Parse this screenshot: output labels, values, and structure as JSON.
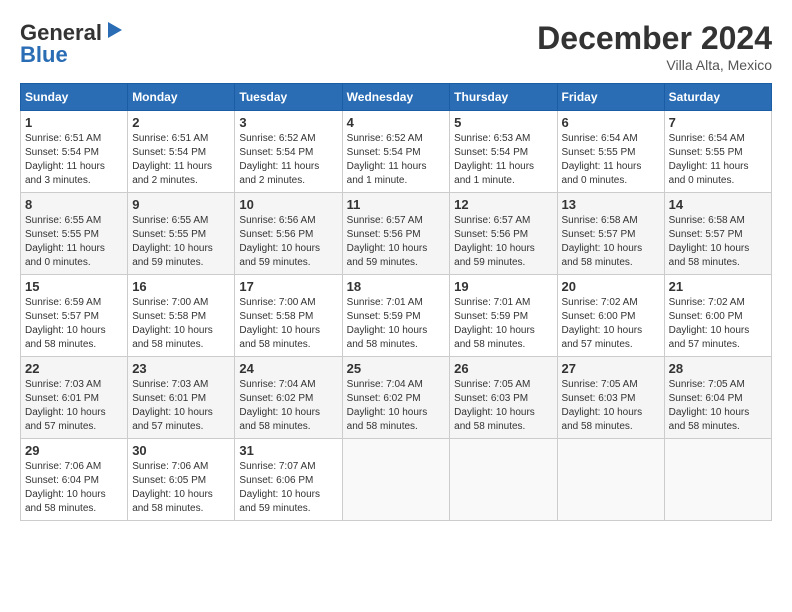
{
  "header": {
    "logo_general": "General",
    "logo_blue": "Blue",
    "month_title": "December 2024",
    "location": "Villa Alta, Mexico"
  },
  "calendar": {
    "days_of_week": [
      "Sunday",
      "Monday",
      "Tuesday",
      "Wednesday",
      "Thursday",
      "Friday",
      "Saturday"
    ],
    "weeks": [
      [
        {
          "day": "1",
          "sunrise": "6:51 AM",
          "sunset": "5:54 PM",
          "daylight": "11 hours and 3 minutes."
        },
        {
          "day": "2",
          "sunrise": "6:51 AM",
          "sunset": "5:54 PM",
          "daylight": "11 hours and 2 minutes."
        },
        {
          "day": "3",
          "sunrise": "6:52 AM",
          "sunset": "5:54 PM",
          "daylight": "11 hours and 2 minutes."
        },
        {
          "day": "4",
          "sunrise": "6:52 AM",
          "sunset": "5:54 PM",
          "daylight": "11 hours and 1 minute."
        },
        {
          "day": "5",
          "sunrise": "6:53 AM",
          "sunset": "5:54 PM",
          "daylight": "11 hours and 1 minute."
        },
        {
          "day": "6",
          "sunrise": "6:54 AM",
          "sunset": "5:55 PM",
          "daylight": "11 hours and 0 minutes."
        },
        {
          "day": "7",
          "sunrise": "6:54 AM",
          "sunset": "5:55 PM",
          "daylight": "11 hours and 0 minutes."
        }
      ],
      [
        {
          "day": "8",
          "sunrise": "6:55 AM",
          "sunset": "5:55 PM",
          "daylight": "11 hours and 0 minutes."
        },
        {
          "day": "9",
          "sunrise": "6:55 AM",
          "sunset": "5:55 PM",
          "daylight": "10 hours and 59 minutes."
        },
        {
          "day": "10",
          "sunrise": "6:56 AM",
          "sunset": "5:56 PM",
          "daylight": "10 hours and 59 minutes."
        },
        {
          "day": "11",
          "sunrise": "6:57 AM",
          "sunset": "5:56 PM",
          "daylight": "10 hours and 59 minutes."
        },
        {
          "day": "12",
          "sunrise": "6:57 AM",
          "sunset": "5:56 PM",
          "daylight": "10 hours and 59 minutes."
        },
        {
          "day": "13",
          "sunrise": "6:58 AM",
          "sunset": "5:57 PM",
          "daylight": "10 hours and 58 minutes."
        },
        {
          "day": "14",
          "sunrise": "6:58 AM",
          "sunset": "5:57 PM",
          "daylight": "10 hours and 58 minutes."
        }
      ],
      [
        {
          "day": "15",
          "sunrise": "6:59 AM",
          "sunset": "5:57 PM",
          "daylight": "10 hours and 58 minutes."
        },
        {
          "day": "16",
          "sunrise": "7:00 AM",
          "sunset": "5:58 PM",
          "daylight": "10 hours and 58 minutes."
        },
        {
          "day": "17",
          "sunrise": "7:00 AM",
          "sunset": "5:58 PM",
          "daylight": "10 hours and 58 minutes."
        },
        {
          "day": "18",
          "sunrise": "7:01 AM",
          "sunset": "5:59 PM",
          "daylight": "10 hours and 58 minutes."
        },
        {
          "day": "19",
          "sunrise": "7:01 AM",
          "sunset": "5:59 PM",
          "daylight": "10 hours and 58 minutes."
        },
        {
          "day": "20",
          "sunrise": "7:02 AM",
          "sunset": "6:00 PM",
          "daylight": "10 hours and 57 minutes."
        },
        {
          "day": "21",
          "sunrise": "7:02 AM",
          "sunset": "6:00 PM",
          "daylight": "10 hours and 57 minutes."
        }
      ],
      [
        {
          "day": "22",
          "sunrise": "7:03 AM",
          "sunset": "6:01 PM",
          "daylight": "10 hours and 57 minutes."
        },
        {
          "day": "23",
          "sunrise": "7:03 AM",
          "sunset": "6:01 PM",
          "daylight": "10 hours and 57 minutes."
        },
        {
          "day": "24",
          "sunrise": "7:04 AM",
          "sunset": "6:02 PM",
          "daylight": "10 hours and 58 minutes."
        },
        {
          "day": "25",
          "sunrise": "7:04 AM",
          "sunset": "6:02 PM",
          "daylight": "10 hours and 58 minutes."
        },
        {
          "day": "26",
          "sunrise": "7:05 AM",
          "sunset": "6:03 PM",
          "daylight": "10 hours and 58 minutes."
        },
        {
          "day": "27",
          "sunrise": "7:05 AM",
          "sunset": "6:03 PM",
          "daylight": "10 hours and 58 minutes."
        },
        {
          "day": "28",
          "sunrise": "7:05 AM",
          "sunset": "6:04 PM",
          "daylight": "10 hours and 58 minutes."
        }
      ],
      [
        {
          "day": "29",
          "sunrise": "7:06 AM",
          "sunset": "6:04 PM",
          "daylight": "10 hours and 58 minutes."
        },
        {
          "day": "30",
          "sunrise": "7:06 AM",
          "sunset": "6:05 PM",
          "daylight": "10 hours and 58 minutes."
        },
        {
          "day": "31",
          "sunrise": "7:07 AM",
          "sunset": "6:06 PM",
          "daylight": "10 hours and 59 minutes."
        },
        null,
        null,
        null,
        null
      ]
    ]
  }
}
